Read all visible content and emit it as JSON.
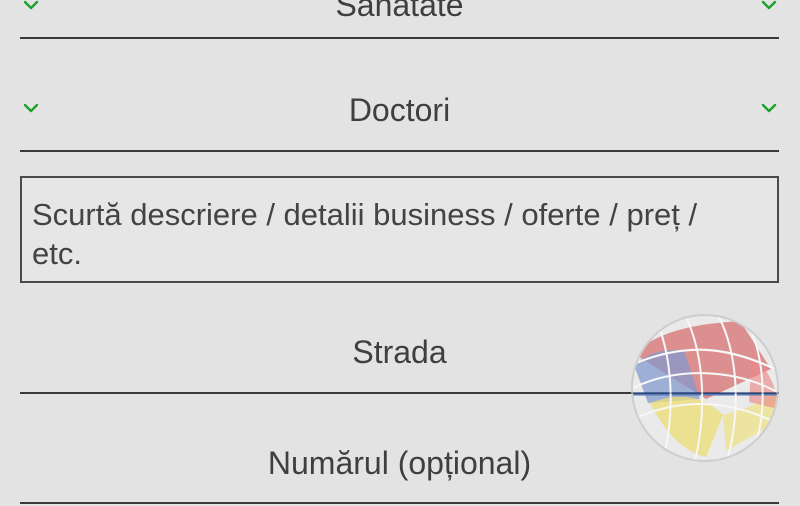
{
  "categories": {
    "top_label": "Sanatate",
    "dropdown_label": "Doctori",
    "accent_color": "#1ea12a"
  },
  "description": {
    "placeholder": "Scurtă descriere / detalii business / oferte / preț / etc."
  },
  "address": {
    "street_placeholder": "Strada",
    "number_placeholder": "Numărul (opțional)"
  },
  "icons": {
    "chevron": "chevron-down-icon",
    "watermark": "globe-logo-watermark"
  }
}
